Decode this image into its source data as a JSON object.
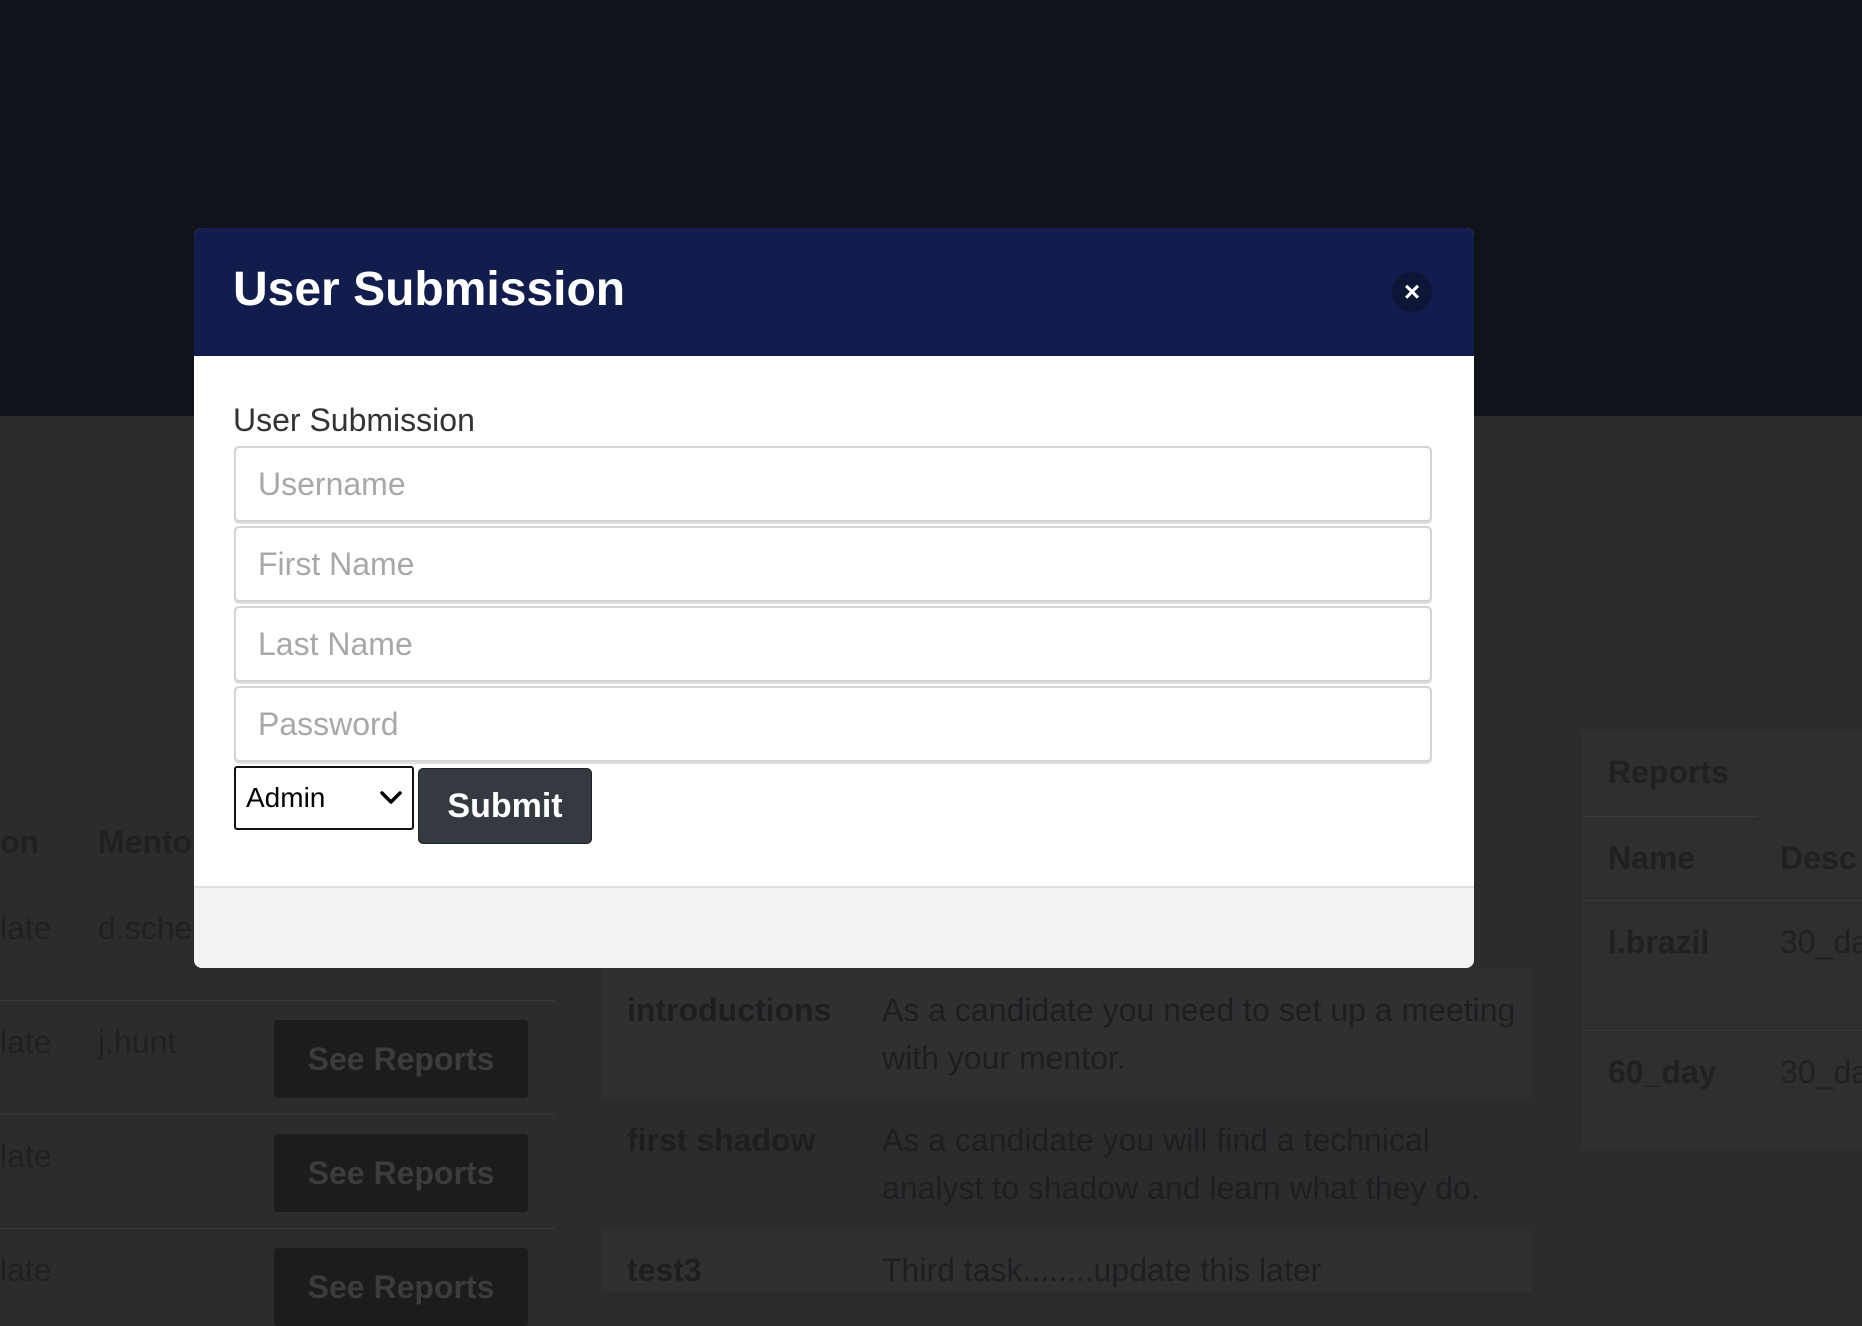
{
  "modal": {
    "title": "User Submission",
    "close_label": "×",
    "form_label": "User Submission",
    "fields": {
      "username_placeholder": "Username",
      "first_name_placeholder": "First Name",
      "last_name_placeholder": "Last Name",
      "password_placeholder": "Password"
    },
    "role_select": {
      "selected": "Admin"
    },
    "submit_label": "Submit"
  },
  "background": {
    "users_table": {
      "headers": [
        "on",
        "Mento"
      ],
      "rows": [
        {
          "role": "late",
          "mentor": "d.sche",
          "action": "See Reports"
        },
        {
          "role": "late",
          "mentor": "j.hunt",
          "action": "See Reports"
        },
        {
          "role": "late",
          "mentor": "",
          "action": "See Reports"
        },
        {
          "role": "late",
          "mentor": "",
          "action": "See Reports"
        }
      ]
    },
    "tasks": [
      {
        "name": "introductions",
        "description": "As a candidate you need to set up a meeting with your mentor."
      },
      {
        "name": "first shadow",
        "description": "As a candidate you will find a technical analyst to shadow and learn what they do."
      },
      {
        "name": "test3",
        "description": "Third task........update this later"
      }
    ],
    "reports": {
      "title": "Reports",
      "headers": [
        "Name",
        "Desc"
      ],
      "rows": [
        {
          "name": "l.brazil",
          "desc": "30_da"
        },
        {
          "name": "60_day",
          "desc": "30_da"
        }
      ]
    }
  },
  "colors": {
    "modal_header": "#121d4d",
    "submit_button": "#343a40",
    "topbar": "#11131a"
  }
}
